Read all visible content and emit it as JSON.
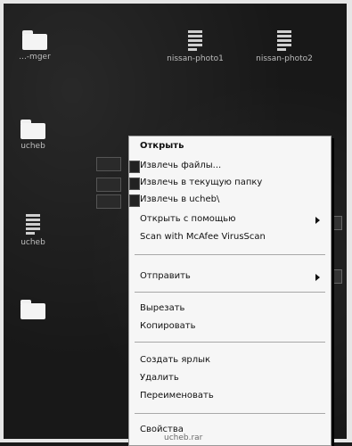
{
  "desktop": {
    "icons": [
      {
        "name": "folder-icon",
        "label": "...-mger"
      },
      {
        "name": "archive-icon",
        "label": "nissan-photo1"
      },
      {
        "name": "archive-icon",
        "label": "nissan-photo2"
      },
      {
        "name": "folder-icon",
        "label": "ucheb"
      },
      {
        "name": "archive-icon",
        "label": "ucheb"
      },
      {
        "name": "folder-icon",
        "label": ""
      }
    ]
  },
  "context_menu": {
    "open": "Открыть",
    "extract_files": "Извлечь файлы...",
    "extract_here": "Извлечь в текущую папку",
    "extract_to": "Извлечь в ucheb\\",
    "open_with": "Открыть с помощью",
    "scan": "Scan with McAfee VirusScan",
    "send_to": "Отправить",
    "cut": "Вырезать",
    "copy": "Копировать",
    "create_shortcut": "Создать ярлык",
    "delete": "Удалить",
    "rename": "Переименовать",
    "properties": "Свойства"
  },
  "caption": "ucheb.rar"
}
